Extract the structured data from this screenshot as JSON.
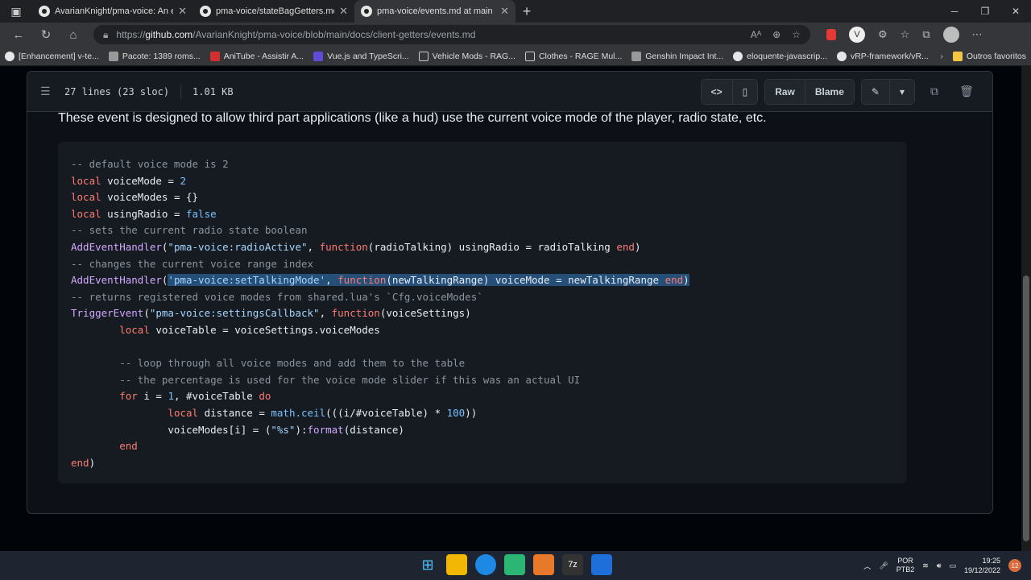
{
  "browser": {
    "tabs": [
      {
        "title": "AvarianKnight/pma-voice: An ea",
        "active": false
      },
      {
        "title": "pma-voice/stateBagGetters.md a",
        "active": false
      },
      {
        "title": "pma-voice/events.md at main · A",
        "active": true
      }
    ],
    "url_prefix": "https://",
    "url_host": "github.com",
    "url_path": "/AvarianKnight/pma-voice/blob/main/docs/client-getters/events.md",
    "bookmarks": [
      {
        "label": "[Enhancement] v-te...",
        "icon": "github-icon"
      },
      {
        "label": "Pacote: 1389 roms...",
        "icon": "page-icon"
      },
      {
        "label": "AniTube - Assistir A...",
        "icon": "red-icon"
      },
      {
        "label": "Vue.js and TypeScri...",
        "icon": "vue-icon"
      },
      {
        "label": "Vehicle Mods - RAG...",
        "icon": "page-icon"
      },
      {
        "label": "Clothes - RAGE Mul...",
        "icon": "page-icon"
      },
      {
        "label": "Genshin Impact Int...",
        "icon": "page-icon"
      },
      {
        "label": "eloquente-javascrip...",
        "icon": "github-icon"
      },
      {
        "label": "vRP-framework/vR...",
        "icon": "github-icon"
      }
    ],
    "bookmarks_other": "Outros favoritos"
  },
  "file": {
    "lines_info": "27 lines (23 sloc)",
    "size": "1.01 KB",
    "raw_label": "Raw",
    "blame_label": "Blame",
    "description": "These event is designed to allow third part applications (like a hud) use the current voice mode of the player, radio state, etc."
  },
  "code_lines": [
    [
      {
        "t": "-- default voice mode is 2",
        "c": "com"
      }
    ],
    [
      {
        "t": "local",
        "c": "kw"
      },
      {
        "t": " voiceMode = ",
        "c": "txt"
      },
      {
        "t": "2",
        "c": "num"
      }
    ],
    [
      {
        "t": "local",
        "c": "kw"
      },
      {
        "t": " voiceModes = {}",
        "c": "txt"
      }
    ],
    [
      {
        "t": "local",
        "c": "kw"
      },
      {
        "t": " usingRadio = ",
        "c": "txt"
      },
      {
        "t": "false",
        "c": "num"
      }
    ],
    [
      {
        "t": "-- sets the current radio state boolean",
        "c": "com"
      }
    ],
    [
      {
        "t": "AddEventHandler",
        "c": "fn"
      },
      {
        "t": "(",
        "c": "txt"
      },
      {
        "t": "\"pma-voice:radioActive\"",
        "c": "str"
      },
      {
        "t": ", ",
        "c": "txt"
      },
      {
        "t": "function",
        "c": "kw"
      },
      {
        "t": "(radioTalking) usingRadio = radioTalking ",
        "c": "txt"
      },
      {
        "t": "end",
        "c": "kw"
      },
      {
        "t": ")",
        "c": "txt"
      }
    ],
    [
      {
        "t": "-- changes the current voice range index",
        "c": "com"
      }
    ],
    [
      {
        "t": "AddEventHandler",
        "c": "fn"
      },
      {
        "t": "(",
        "c": "txt"
      },
      {
        "t": "'pma-voice:setTalkingMode'",
        "c": "str",
        "s": 1
      },
      {
        "t": ", ",
        "c": "txt",
        "s": 1
      },
      {
        "t": "function",
        "c": "kw",
        "s": 1
      },
      {
        "t": "(newTalkingRange) voiceMode = newTalkingRange ",
        "c": "txt",
        "s": 1
      },
      {
        "t": "end",
        "c": "kw",
        "s": 1
      },
      {
        "t": ")",
        "c": "txt",
        "s": 1
      }
    ],
    [
      {
        "t": "-- returns registered voice modes from shared.lua's `Cfg.voiceModes`",
        "c": "com"
      }
    ],
    [
      {
        "t": "TriggerEvent",
        "c": "fn"
      },
      {
        "t": "(",
        "c": "txt"
      },
      {
        "t": "\"pma-voice:settingsCallback\"",
        "c": "str"
      },
      {
        "t": ", ",
        "c": "txt"
      },
      {
        "t": "function",
        "c": "kw"
      },
      {
        "t": "(voiceSettings)",
        "c": "txt"
      }
    ],
    [
      {
        "t": "        ",
        "c": "txt"
      },
      {
        "t": "local",
        "c": "kw"
      },
      {
        "t": " voiceTable = voiceSettings.voiceModes",
        "c": "txt"
      }
    ],
    [
      {
        "t": "",
        "c": "txt"
      }
    ],
    [
      {
        "t": "        -- loop through all voice modes and add them to the table",
        "c": "com"
      }
    ],
    [
      {
        "t": "        -- the percentage is used for the voice mode slider if this was an actual UI",
        "c": "com"
      }
    ],
    [
      {
        "t": "        ",
        "c": "txt"
      },
      {
        "t": "for",
        "c": "kw"
      },
      {
        "t": " i = ",
        "c": "txt"
      },
      {
        "t": "1",
        "c": "num"
      },
      {
        "t": ", #voiceTable ",
        "c": "txt"
      },
      {
        "t": "do",
        "c": "kw"
      }
    ],
    [
      {
        "t": "                ",
        "c": "txt"
      },
      {
        "t": "local",
        "c": "kw"
      },
      {
        "t": " distance = ",
        "c": "txt"
      },
      {
        "t": "math.ceil",
        "c": "num"
      },
      {
        "t": "(((i/#voiceTable) * ",
        "c": "txt"
      },
      {
        "t": "100",
        "c": "num"
      },
      {
        "t": "))",
        "c": "txt"
      }
    ],
    [
      {
        "t": "                voiceModes[i] = (",
        "c": "txt"
      },
      {
        "t": "\"%s\"",
        "c": "str"
      },
      {
        "t": "):",
        "c": "txt"
      },
      {
        "t": "format",
        "c": "fn"
      },
      {
        "t": "(distance)",
        "c": "txt"
      }
    ],
    [
      {
        "t": "        ",
        "c": "txt"
      },
      {
        "t": "end",
        "c": "kw"
      }
    ],
    [
      {
        "t": "end",
        "c": "kw"
      },
      {
        "t": ")",
        "c": "txt"
      }
    ]
  ],
  "taskbar": {
    "lang_top": "POR",
    "lang_bottom": "PTB2",
    "time": "19:25",
    "date": "19/12/2022",
    "notifications": "12"
  },
  "colors": {
    "comment": "#8b949e",
    "keyword": "#ff7b72",
    "function": "#d2a8ff",
    "string": "#a5d6ff",
    "number": "#79c0ff",
    "selection": "#264f78"
  }
}
